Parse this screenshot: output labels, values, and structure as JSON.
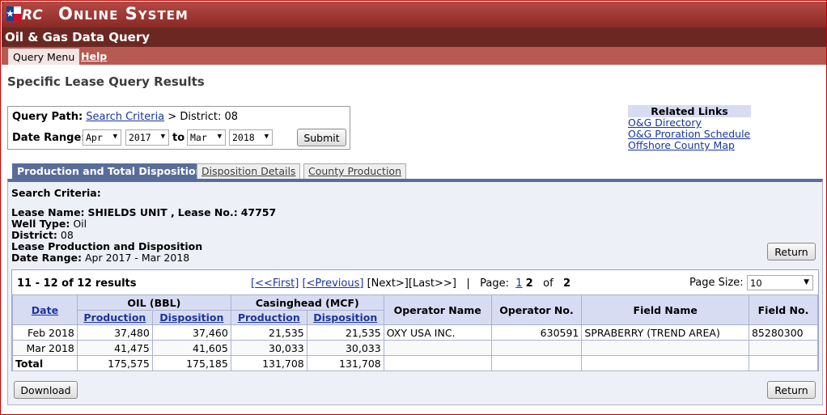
{
  "header": {
    "logo_text": "RRC",
    "system_title": "Online System",
    "app_title": "Oil & Gas Data Query"
  },
  "menu": {
    "query_menu": "Query Menu",
    "help": "Help"
  },
  "page_title": "Specific Lease Query Results",
  "query_path": {
    "label": "Query Path:",
    "link": "Search Criteria",
    "rest": "> District: 08"
  },
  "date_range": {
    "label": "Date Range:",
    "from_month": "Apr",
    "from_year": "2017",
    "to_label": "to",
    "to_month": "Mar",
    "to_year": "2018",
    "submit": "Submit"
  },
  "related_links": {
    "title": "Related Links",
    "links": [
      "O&G Directory",
      "O&G Proration Schedule",
      "Offshore County Map"
    ]
  },
  "tabs": [
    "Production and Total Disposition",
    "Disposition Details",
    "County Production"
  ],
  "criteria": {
    "title": "Search Criteria:",
    "lease_label": "Lease Name:",
    "lease_name": "SHIELDS UNIT ,",
    "lease_no_label": "Lease No.:",
    "lease_no": "47757",
    "well_type_label": "Well Type:",
    "well_type": "Oil",
    "district_label": "District:",
    "district": "08",
    "section": "Lease Production and Disposition",
    "date_range_label": "Date Range:",
    "date_range": "Apr 2017 - Mar 2018"
  },
  "return_label": "Return",
  "download_label": "Download",
  "results": {
    "count": "11 - 12 of 12 results",
    "first": "[<<First]",
    "previous": "[<Previous]",
    "next_last": "[Next>][Last>>]",
    "sep": "|",
    "page_label": "Page:",
    "page_link": "1",
    "page_current": "2",
    "of_label": "of",
    "total_pages": "2",
    "page_size_label": "Page Size:",
    "page_size": "10"
  },
  "table": {
    "headers": {
      "date": "Date",
      "oil": "OIL (BBL)",
      "casinghead": "Casinghead (MCF)",
      "production": "Production",
      "disposition": "Disposition",
      "operator_name": "Operator Name",
      "operator_no": "Operator No.",
      "field_name": "Field Name",
      "field_no": "Field No."
    },
    "rows": [
      {
        "date": "Feb 2018",
        "oil_prod": "37,480",
        "oil_disp": "37,460",
        "gas_prod": "21,535",
        "gas_disp": "21,535",
        "operator_name": "OXY USA INC.",
        "operator_no": "630591",
        "field_name": "SPRABERRY (TREND AREA)",
        "field_no": "85280300"
      },
      {
        "date": "Mar 2018",
        "oil_prod": "41,475",
        "oil_disp": "41,605",
        "gas_prod": "30,033",
        "gas_disp": "30,033",
        "operator_name": "",
        "operator_no": "",
        "field_name": "",
        "field_no": ""
      }
    ],
    "total": {
      "label": "Total",
      "oil_prod": "175,575",
      "oil_disp": "175,185",
      "gas_prod": "131,708",
      "gas_disp": "131,708"
    }
  }
}
